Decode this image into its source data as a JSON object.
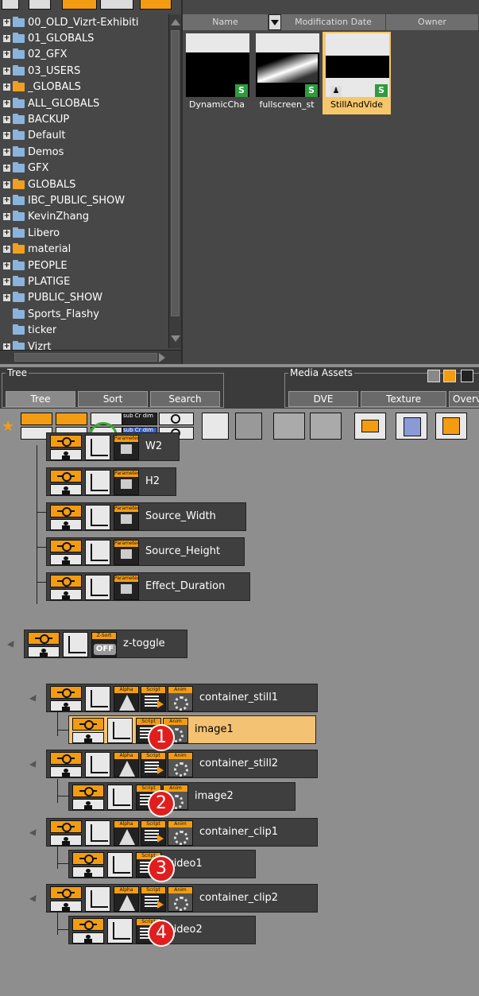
{
  "folder_tree": {
    "items": [
      {
        "label": "00_OLD_Vizrt-Exhibiti",
        "expandable": true,
        "folder_color": "blue"
      },
      {
        "label": "01_GLOBALS",
        "expandable": true,
        "folder_color": "blue"
      },
      {
        "label": "02_GFX",
        "expandable": true,
        "folder_color": "blue"
      },
      {
        "label": "03_USERS",
        "expandable": true,
        "folder_color": "blue"
      },
      {
        "label": "_GLOBALS",
        "expandable": true,
        "folder_color": "orange"
      },
      {
        "label": "ALL_GLOBALS",
        "expandable": true,
        "folder_color": "blue"
      },
      {
        "label": "BACKUP",
        "expandable": true,
        "folder_color": "blue"
      },
      {
        "label": "Default",
        "expandable": true,
        "folder_color": "blue"
      },
      {
        "label": "Demos",
        "expandable": true,
        "folder_color": "blue"
      },
      {
        "label": "GFX",
        "expandable": true,
        "folder_color": "blue"
      },
      {
        "label": "GLOBALS",
        "expandable": true,
        "folder_color": "orange"
      },
      {
        "label": "IBC_PUBLIC_SHOW",
        "expandable": true,
        "folder_color": "blue"
      },
      {
        "label": "KevinZhang",
        "expandable": true,
        "folder_color": "blue"
      },
      {
        "label": "Libero",
        "expandable": true,
        "folder_color": "blue"
      },
      {
        "label": "material",
        "expandable": true,
        "folder_color": "orange"
      },
      {
        "label": "PEOPLE",
        "expandable": true,
        "folder_color": "blue"
      },
      {
        "label": "PLATIGE",
        "expandable": true,
        "folder_color": "blue"
      },
      {
        "label": "PUBLIC_SHOW",
        "expandable": true,
        "folder_color": "blue"
      },
      {
        "label": "Sports_Flashy",
        "expandable": false,
        "folder_color": "blue"
      },
      {
        "label": "ticker",
        "expandable": false,
        "folder_color": "blue"
      },
      {
        "label": "Vizrt",
        "expandable": true,
        "folder_color": "blue"
      }
    ]
  },
  "asset_list": {
    "columns": [
      "Name",
      "Modification Date",
      "Owner"
    ],
    "items": [
      {
        "label": "DynamicCha",
        "preview": "black",
        "badge": "S",
        "selected": false
      },
      {
        "label": "fullscreen_st",
        "preview": "gradient",
        "badge": "S",
        "selected": false
      },
      {
        "label": "StillAndVide",
        "preview": "still",
        "badge": "S",
        "selected": true
      }
    ]
  },
  "tabs_left": {
    "legend": "Tree",
    "tabs": [
      "Tree",
      "Sort",
      "Search"
    ]
  },
  "tabs_right": {
    "legend": "Media Assets",
    "tabs": [
      "DVE",
      "Texture",
      "Overv"
    ]
  },
  "toolbar": {
    "sub_label_1": "sub Cr dim",
    "sub_label_2": "sub Cr dim"
  },
  "scene_tree": {
    "plugin_headers": {
      "parameter": "Parameter",
      "alpha": "Alpha",
      "script": "Script",
      "anim": "Anim",
      "zsort": "Z-Sort",
      "zsort_state": "OFF"
    },
    "nodes": [
      {
        "label": "W2"
      },
      {
        "label": "H2"
      },
      {
        "label": "Source_Width"
      },
      {
        "label": "Source_Height"
      },
      {
        "label": "Effect_Duration"
      },
      {
        "label": "z-toggle"
      },
      {
        "label": "container_still1"
      },
      {
        "label": "image1"
      },
      {
        "label": "container_still2"
      },
      {
        "label": "image2"
      },
      {
        "label": "container_clip1"
      },
      {
        "label": "video1"
      },
      {
        "label": "container_clip2"
      },
      {
        "label": "video2"
      }
    ],
    "badges": [
      "1",
      "2",
      "3",
      "4"
    ]
  },
  "colors": {
    "accent_orange": "#f39c12",
    "selection": "#f3c273",
    "badge_red": "#e01e1e",
    "highlight_green": "#3aaa35"
  }
}
